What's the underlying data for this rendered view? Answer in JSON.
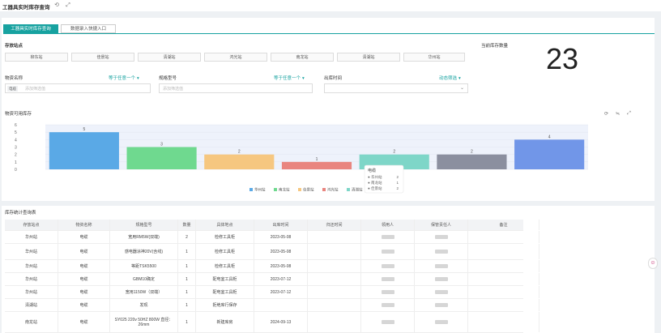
{
  "window": {
    "title": "工器具实时库存查询"
  },
  "tabs": [
    {
      "label": "工器具实时库存查询",
      "active": true
    },
    {
      "label": "数据录入快捷入口",
      "active": false
    }
  ],
  "filters": {
    "stations_label": "存放站点",
    "stations": [
      "柳东站",
      "佳景站",
      "清湖站",
      "鸿光站",
      "南龙站",
      "清湖站",
      "华州站"
    ],
    "current_stock_label": "当前库存数量",
    "current_stock_value": "23",
    "item_name_label": "物资名称",
    "item_name_link": "等于任意一个",
    "item_name_tag": "电缆",
    "item_name_placeholder": "添加筛选值",
    "spec_label": "规格型号",
    "spec_link": "等于任意一个",
    "spec_placeholder": "添加筛选值",
    "out_time_label": "出库时间",
    "out_time_link": "动态筛选"
  },
  "chart_data": {
    "type": "bar",
    "title": "物资可用库存",
    "categories": [
      "华州站",
      "南龙站",
      "佳景站",
      "鸿光站",
      "清湖站",
      "",
      ""
    ],
    "values": [
      5,
      3,
      2,
      1,
      2,
      2,
      4
    ],
    "colors": [
      "#5aa9e6",
      "#6fd98f",
      "#f6c780",
      "#e9857f",
      "#7ed6c8",
      "#8b8f9f",
      "#7196e8"
    ],
    "ylim": [
      0,
      6
    ],
    "yticks": [
      0,
      1,
      2,
      3,
      4,
      5,
      6
    ],
    "legend": [
      "华州站",
      "南龙站",
      "佳景站",
      "鸿光站",
      "清湖站"
    ],
    "legend_position": "bottom",
    "tooltip_title": "电缆",
    "tooltip_rows": [
      {
        "label": "华州站",
        "value": "2"
      },
      {
        "label": "南龙站",
        "value": "1"
      },
      {
        "label": "佳景站",
        "value": "2"
      }
    ]
  },
  "table": {
    "caption": "库存统计查询表",
    "columns": [
      "存放站点",
      "物资名称",
      "规格型号",
      "数量",
      "具体地点",
      "出库时间",
      "归还时间",
      "领用人",
      "保管责任人",
      "备注"
    ],
    "rows": [
      [
        "华州站",
        "电缆",
        "宽用RM5W(双端)",
        "2",
        "检修工具柜",
        "2023-05-08",
        "",
        "",
        "",
        ""
      ],
      [
        "华州站",
        "电缆",
        "感电器涂神20V(含线)",
        "1",
        "检修工具柜",
        "2023-05-08",
        "",
        "",
        "",
        ""
      ],
      [
        "华州站",
        "电缆",
        "等距TSK5500",
        "1",
        "检修工具柜",
        "2023-05-08",
        "",
        "",
        "",
        ""
      ],
      [
        "华州站",
        "电缆",
        "GBM10确定",
        "1",
        "配电室工具柜",
        "2023-07-12",
        "",
        "",
        "",
        ""
      ],
      [
        "华州站",
        "电缆",
        "宽用1150W（双端）",
        "1",
        "配电室工具柜",
        "2023-07-12",
        "",
        "",
        "",
        ""
      ],
      [
        "清湖站",
        "电缆",
        "发现",
        "1",
        "拒绝库行保存",
        "",
        "",
        "",
        "",
        ""
      ],
      [
        "南龙站",
        "电缆",
        "SY025 220v 50HZ 800W 直径：26mm",
        "1",
        "新建库房",
        "2024-09-13",
        "",
        "",
        "",
        ""
      ]
    ]
  }
}
